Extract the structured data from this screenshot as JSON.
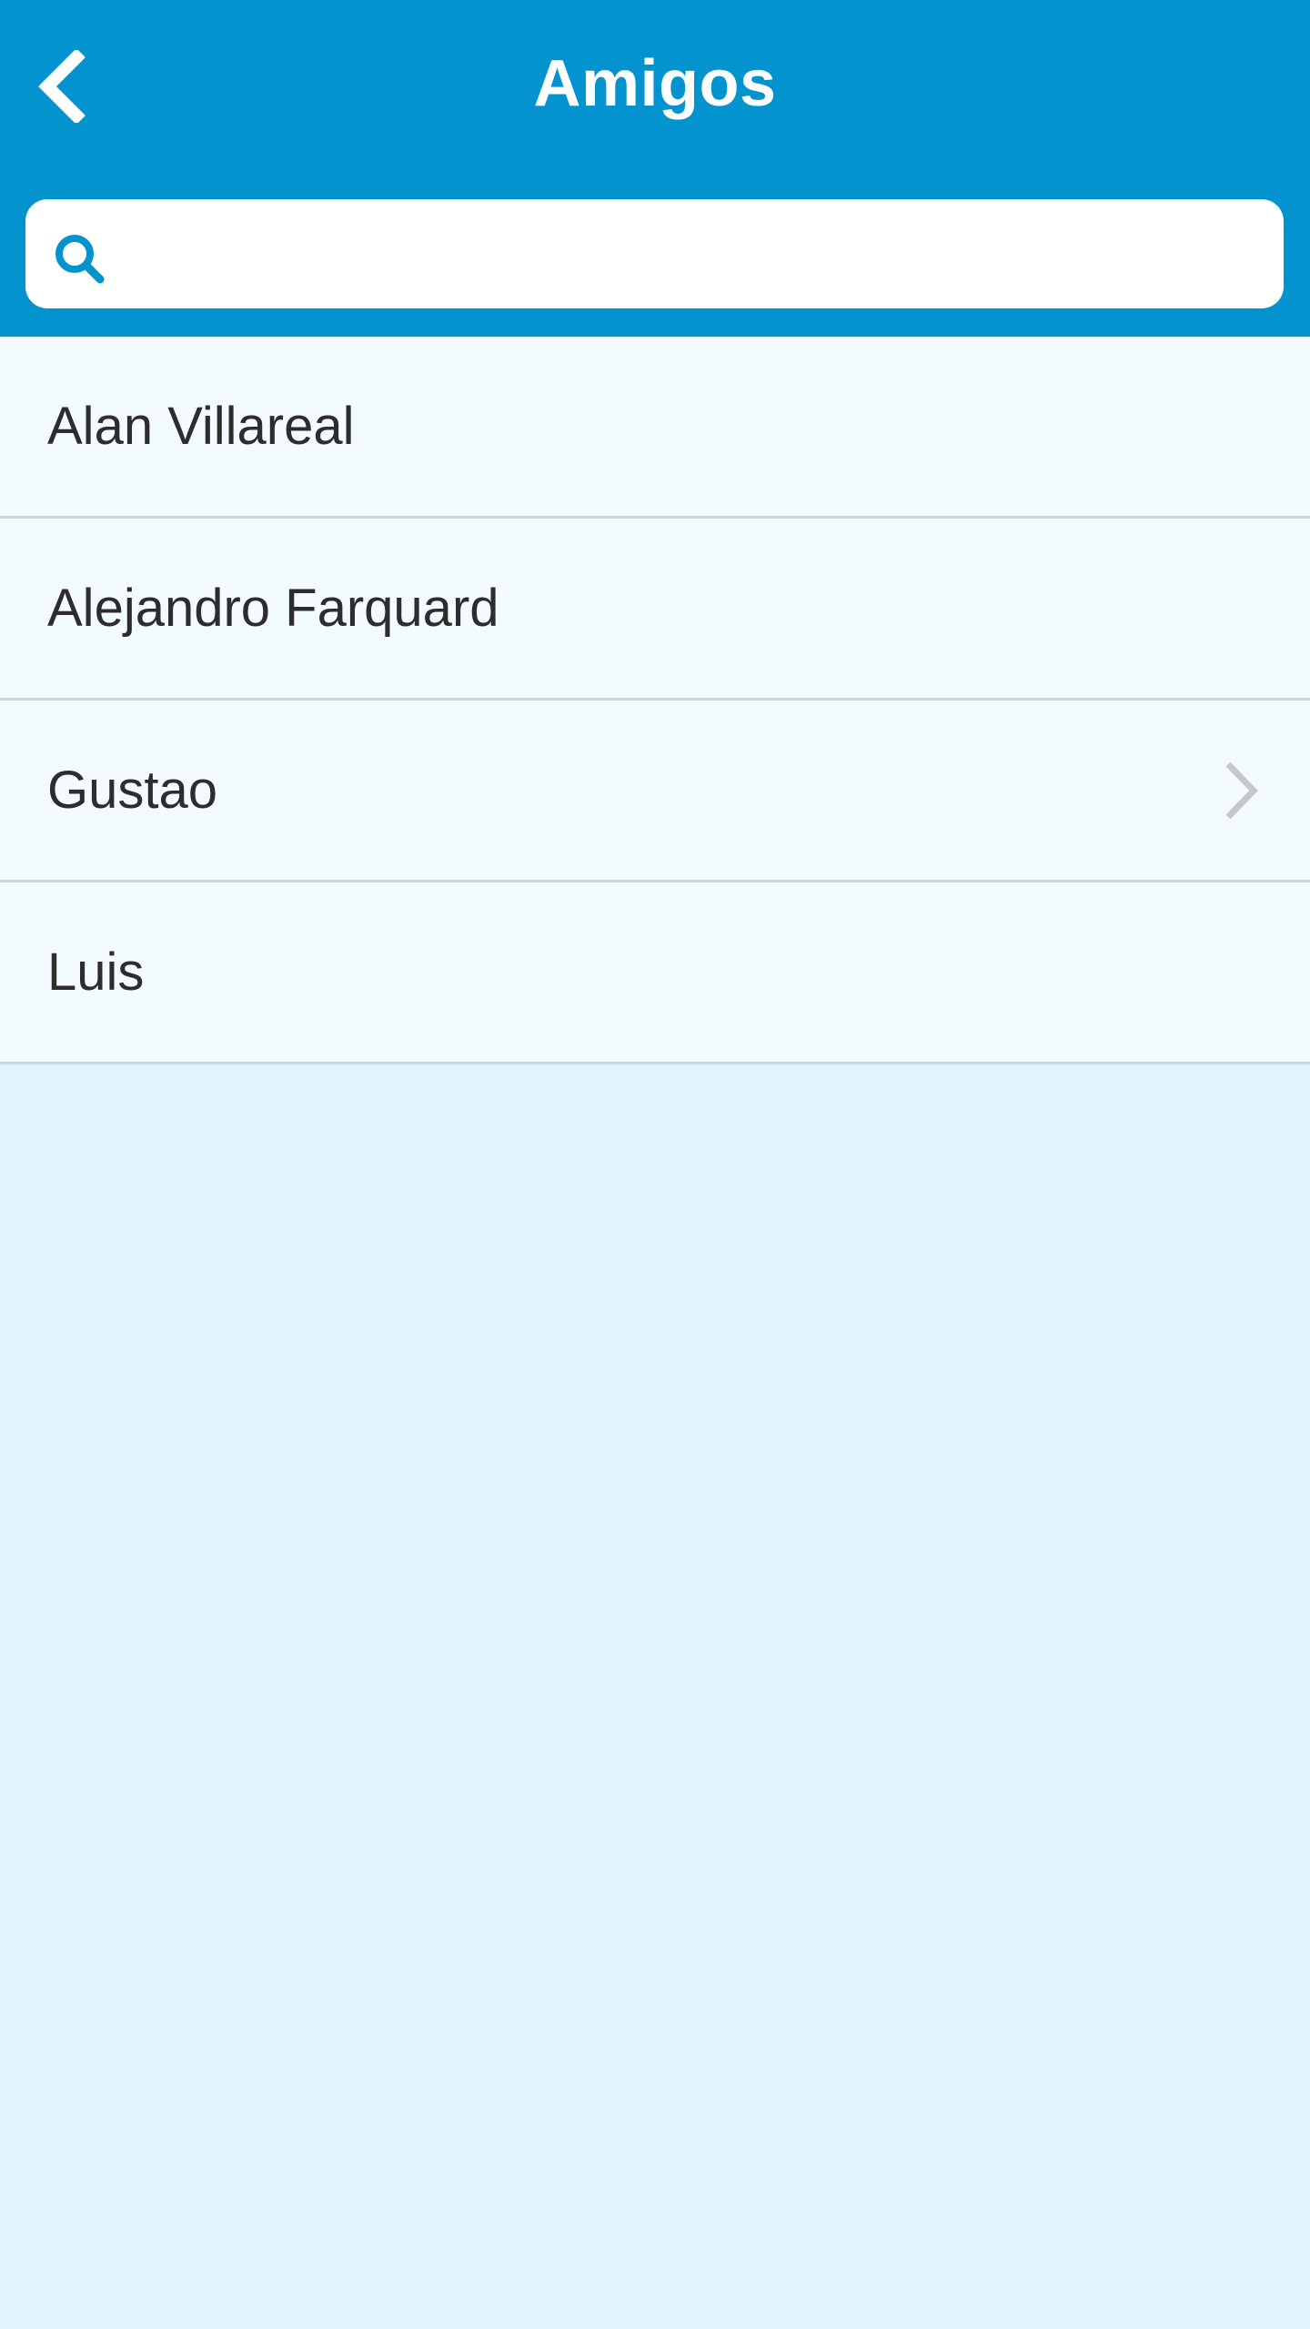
{
  "header": {
    "title": "Amigos",
    "background_color": "#0393cf",
    "back_icon": "chevron-left-icon"
  },
  "search": {
    "placeholder": "",
    "value": "",
    "icon": "search-icon",
    "icon_color": "#0393cf"
  },
  "friends": [
    {
      "name": "Alan Villareal",
      "chevron": false
    },
    {
      "name": "Alejandro Farquard",
      "chevron": false
    },
    {
      "name": "Gustao",
      "chevron": true
    },
    {
      "name": "Luis",
      "chevron": false
    }
  ],
  "colors": {
    "list_background": "#f4fbfe",
    "page_background": "#e2f5fc",
    "divider": "#d0d6da",
    "chevron": "#c8c8c8"
  }
}
